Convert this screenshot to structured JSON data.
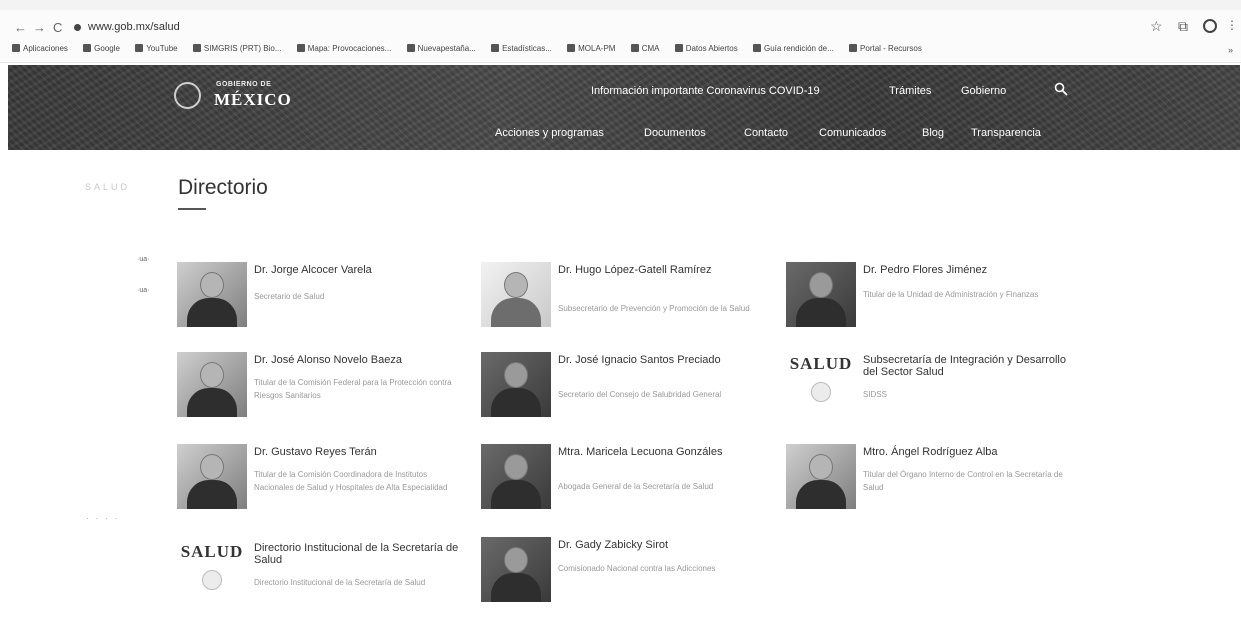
{
  "browser": {
    "url": "www.gob.mx/salud",
    "bookmarks": [
      "Aplicaciones",
      "Google",
      "YouTube",
      "SIMGRIS (PRT) Bio...",
      "Mapa: Provocaciones...",
      "Nuevapestaña...",
      "Estadísticas...",
      "MOLA-PM",
      "CMA",
      "Datos Abiertos",
      "Guía rendición de...",
      "Portal - Recursos"
    ]
  },
  "header": {
    "logo_top": "GOBIERNO DE",
    "logo_main": "MÉXICO",
    "nav_top": [
      "Información importante Coronavirus COVID-19",
      "Trámites",
      "Gobierno"
    ],
    "nav_bottom": [
      "Acciones y programas",
      "Documentos",
      "Contacto",
      "Comunicados",
      "Blog",
      "Transparencia"
    ]
  },
  "page": {
    "breadcrumb": "SALUD",
    "title": "Directorio"
  },
  "cards": [
    {
      "name": "Dr. Jorge Alcocer Varela",
      "role": "Secretario de Salud",
      "image": "portrait"
    },
    {
      "name": "Dr. Hugo López-Gatell Ramírez",
      "role": "Subsecretario de Prevención y Promoción de la Salud",
      "image": "portrait-light"
    },
    {
      "name": "Dr. Pedro Flores Jiménez",
      "role": "Titular de la Unidad de Administración y Finanzas",
      "image": "portrait-dark"
    },
    {
      "name": "Dr. José Alonso Novelo Baeza",
      "role": "Titular de la Comisión Federal para la Protección contra Riesgos Sanitarios",
      "image": "portrait"
    },
    {
      "name": "Dr. José Ignacio Santos Preciado",
      "role": "Secretario del Consejo de Salubridad General",
      "image": "portrait-dark"
    },
    {
      "name": "Subsecretaría de Integración y Desarrollo del Sector Salud",
      "role": "SIDSS",
      "image": "salud-logo"
    },
    {
      "name": "Dr. Gustavo Reyes Terán",
      "role": "Titular de la Comisión Coordinadora de Institutos Nacionales de Salud y Hospitales de Alta Especialidad",
      "image": "portrait"
    },
    {
      "name": "Mtra. Maricela Lecuona Gonzáles",
      "role": "Abogada General de la Secretaría de Salud",
      "image": "portrait-dark"
    },
    {
      "name": "Mtro. Ángel Rodríguez Alba",
      "role": "Titular del Órgano Interno de Control en la Secretaría de Salud",
      "image": "portrait"
    },
    {
      "name": "Directorio Institucional de la Secretaría de Salud",
      "role": "Directorio Institucional de la Secretaría de Salud",
      "image": "salud-logo"
    },
    {
      "name": "Dr. Gady Zabicky Sirot",
      "role": "Comisionado Nacional contra las Adicciones",
      "image": "portrait-dark"
    }
  ],
  "salud_logo_text": "SALUD",
  "icons": {
    "back": "←",
    "forward": "→",
    "reload": "C",
    "star": "☆",
    "search": "search-icon"
  }
}
